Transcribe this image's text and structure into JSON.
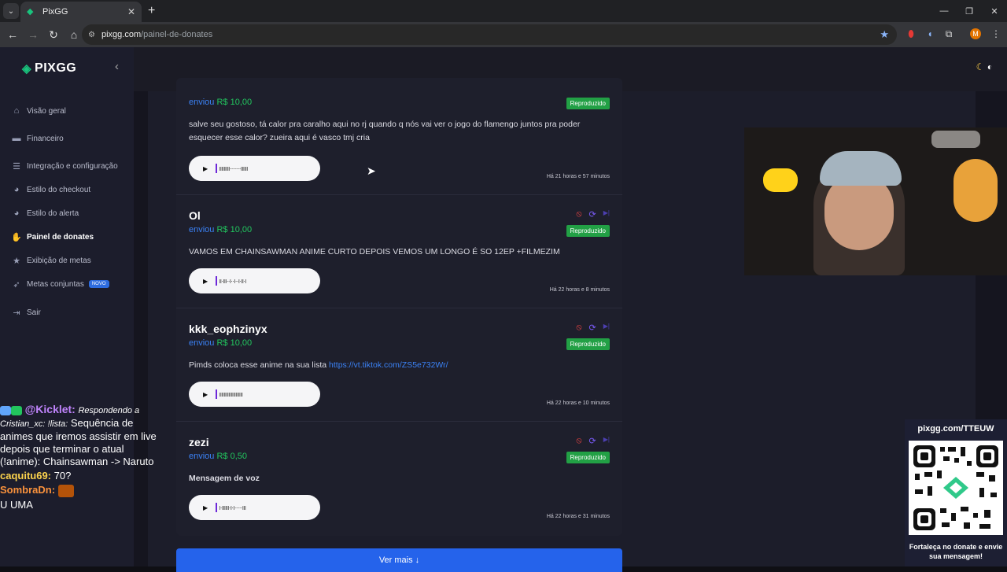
{
  "browser": {
    "tab_title": "PixGG",
    "close_glyph": "✕",
    "new_tab_glyph": "+",
    "url_host": "pixgg.com",
    "url_path": "/painel-de-donates",
    "profile_initial": "M"
  },
  "sidebar": {
    "brand": "PIXGG",
    "items": [
      {
        "label": "Visão geral",
        "icon": "home-icon"
      },
      {
        "label": "Financeiro",
        "icon": "wallet-icon"
      },
      {
        "label": "Integração e configuração",
        "icon": "settings-icon"
      },
      {
        "label": "Estilo do checkout",
        "icon": "palette-icon"
      },
      {
        "label": "Estilo do alerta",
        "icon": "palette-icon"
      },
      {
        "label": "Painel de donates",
        "icon": "donate-icon",
        "active": true
      },
      {
        "label": "Exibição de metas",
        "icon": "star-icon"
      },
      {
        "label": "Metas conjuntas",
        "icon": "rocket-icon",
        "badge": "NOVO"
      },
      {
        "label": "Sair",
        "icon": "logout-icon"
      }
    ]
  },
  "donations": [
    {
      "name": "",
      "verb": "enviou",
      "amount": "R$ 10,00",
      "status": "Reproduzido",
      "message": "salve seu gostoso, tá calor pra caralho aqui no rj quando q nós vai ver o jogo do flamengo juntos pra poder esquecer esse calor? zueira aqui é vasco tmj cria",
      "link": "",
      "time": "Há 21 horas e 57 minutos"
    },
    {
      "name": "Ol",
      "verb": "enviou",
      "amount": "R$ 10,00",
      "status": "Reproduzido",
      "message": "VAMOS EM CHAINSAWMAN ANIME CURTO DEPOIS VEMOS UM LONGO É SO 12EP +FILMEZIM",
      "link": "",
      "time": "Há 22 horas e 8 minutos"
    },
    {
      "name": "kkk_eophzinyx",
      "verb": "enviou",
      "amount": "R$ 10,00",
      "status": "Reproduzido",
      "message": "Pimds coloca esse anime na sua lista ",
      "link": "https://vt.tiktok.com/ZS5e732Wr/",
      "time": "Há 22 horas e 10 minutos"
    },
    {
      "name": "zezi",
      "verb": "enviou",
      "amount": "R$ 0,50",
      "status": "Reproduzido",
      "message": "Mensagem de voz",
      "link": "",
      "time": "Há 22 horas e 31 minutos"
    }
  ],
  "more_button": "Ver mais ↓",
  "chat": {
    "user1": "@Kicklet:",
    "user1_reply": "Respondendo a Cristian_xc: !lista:",
    "user1_msg": "Sequência de animes que iremos assistir em live depois que terminar o atual (!anime): Chainsawman -> Naruto",
    "user2": "caquitu69:",
    "user2_msg": "70?",
    "user3": "SombraDn:",
    "user4_msg": "U UMA"
  },
  "qr": {
    "title": "pixgg.com/TTEUW",
    "caption": "Fortaleça no donate e envie sua mensagem!"
  },
  "colors": {
    "accent": "#2563eb",
    "brand": "#19c37d",
    "status": "#22a045",
    "amount": "#22c55e"
  }
}
